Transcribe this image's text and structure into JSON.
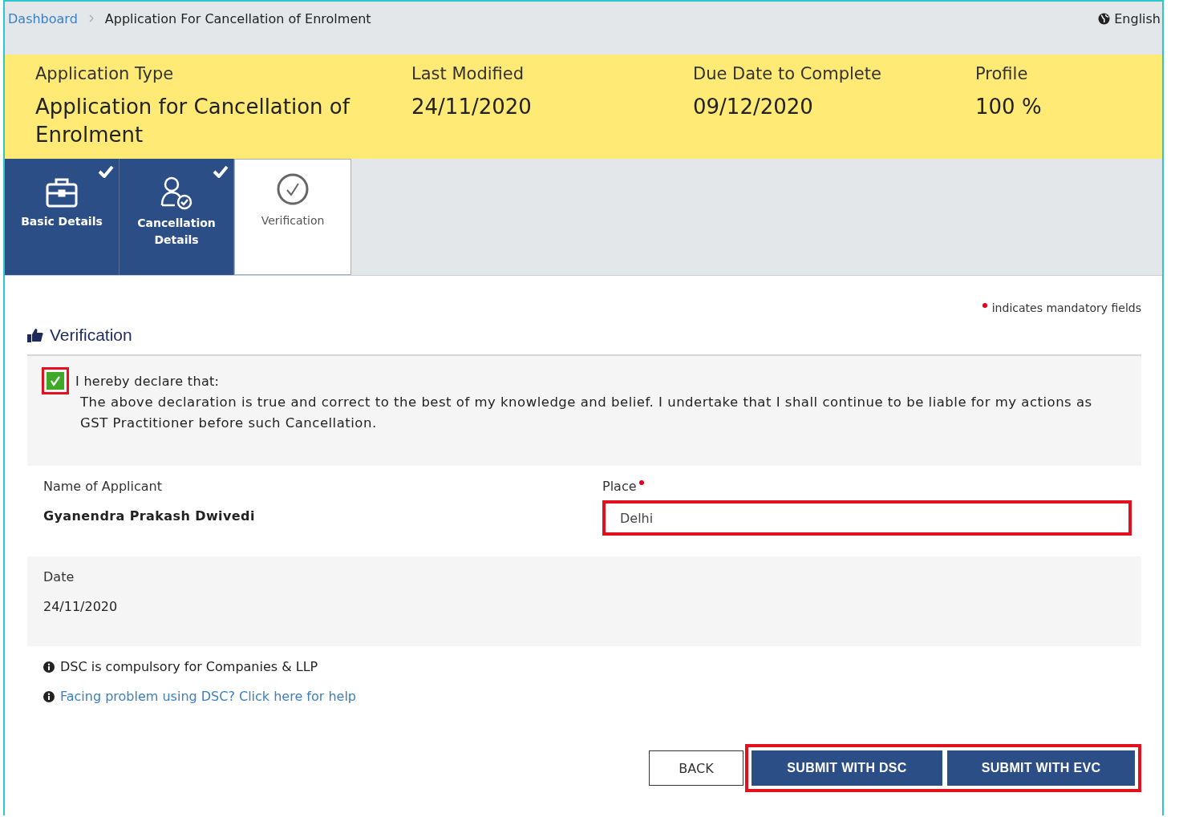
{
  "breadcrumb": [
    {
      "label": "Dashboard",
      "kind": "link"
    },
    {
      "label": "Application For Cancellation of Enrolment",
      "kind": "current"
    }
  ],
  "language": "English",
  "summary": [
    {
      "label": "Application Type",
      "value": "Application for Cancellation of Enrolment"
    },
    {
      "label": "Last Modified",
      "value": "24/11/2020"
    },
    {
      "label": "Due Date to Complete",
      "value": "09/12/2020"
    },
    {
      "label": "Profile",
      "value": "100 %"
    }
  ],
  "steps": [
    {
      "label": "Basic Details",
      "completed": true,
      "selected": false
    },
    {
      "label": "Cancellation Details",
      "completed": true,
      "selected": false
    },
    {
      "label": "Verification",
      "completed": false,
      "selected": true
    }
  ],
  "mandatory_note": "indicates mandatory fields",
  "section_title": "Verification",
  "declaration": {
    "checked": true,
    "highlighted": true,
    "heading": "I hereby declare that:",
    "text": "The above declaration is true and correct to the best of my knowledge and belief. I undertake that I shall continue to be liable for my actions as GST Practitioner before such Cancellation."
  },
  "applicant": {
    "label": "Name of Applicant",
    "value": "Gyanendra Prakash Dwivedi"
  },
  "place": {
    "label": "Place",
    "required": true,
    "value": "Delhi",
    "highlighted": true
  },
  "date": {
    "label": "Date",
    "value": "24/11/2020"
  },
  "notes": [
    {
      "kind": "text",
      "text": "DSC is compulsory for Companies & LLP"
    },
    {
      "kind": "link",
      "text": "Facing problem using DSC? Click here for help"
    }
  ],
  "back_button": {
    "label": "BACK"
  },
  "submit_group": {
    "highlighted": true,
    "buttons": [
      {
        "label": "SUBMIT WITH DSC"
      },
      {
        "label": "SUBMIT WITH EVC"
      }
    ]
  }
}
